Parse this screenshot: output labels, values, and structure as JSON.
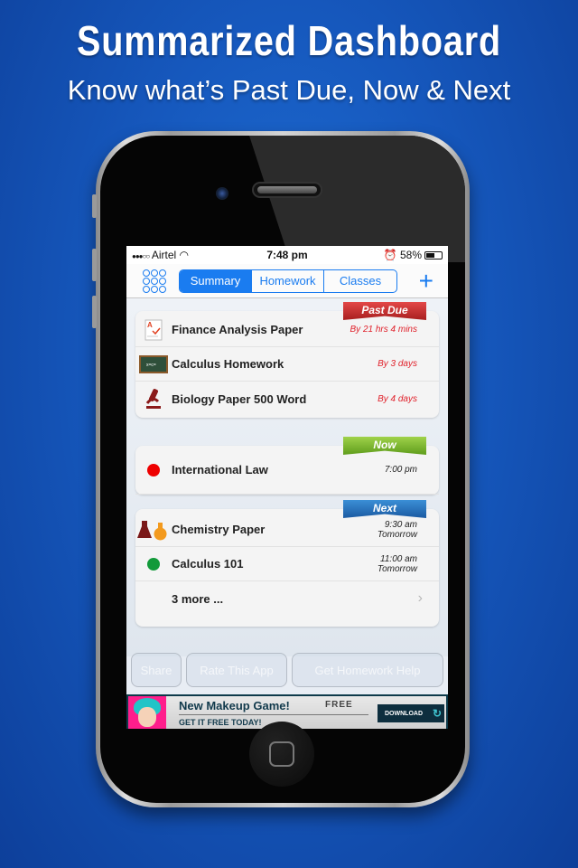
{
  "promo": {
    "headline": "Summarized Dashboard",
    "subheadline": "Know what’s Past Due, Now & Next"
  },
  "status_bar": {
    "signal": "●●●○○",
    "carrier": "Airtel",
    "wifi_icon": "wifi-icon",
    "time": "7:48 pm",
    "alarm_icon": "alarm-icon",
    "battery_text": "58%",
    "battery_level": 0.58
  },
  "nav": {
    "menu_icon": "grid-menu-icon",
    "tabs": [
      {
        "label": "Summary",
        "active": true
      },
      {
        "label": "Homework",
        "active": false
      },
      {
        "label": "Classes",
        "active": false
      }
    ],
    "add_icon": "+"
  },
  "sections": {
    "past_due": {
      "ribbon": "Past Due",
      "ribbon_color": "#c62a2a",
      "items": [
        {
          "icon": "paper-graded-icon",
          "title": "Finance Analysis Paper",
          "due": "By 21 hrs 4 mins"
        },
        {
          "icon": "chalkboard-icon",
          "title": "Calculus Homework",
          "due": "By 3 days"
        },
        {
          "icon": "microscope-icon",
          "title": "Biology Paper 500 Word",
          "due": "By 4 days"
        }
      ]
    },
    "now": {
      "ribbon": "Now",
      "ribbon_color": "#7ab532",
      "items": [
        {
          "icon": "red-dot-icon",
          "color": "#ee0000",
          "title": "International Law",
          "time": "7:00 pm"
        }
      ]
    },
    "next": {
      "ribbon": "Next",
      "ribbon_color": "#2a74c0",
      "items": [
        {
          "icon": "flasks-icon",
          "title": "Chemistry Paper",
          "time": "9:30 am",
          "day": "Tomorrow"
        },
        {
          "icon": "green-dot-icon",
          "color": "#129a3a",
          "title": "Calculus 101",
          "time": "11:00 am",
          "day": "Tomorrow"
        }
      ],
      "more": "3 more ..."
    }
  },
  "buttons": {
    "share": "Share",
    "rate": "Rate This App",
    "help": "Get Homework Help"
  },
  "ad": {
    "title": "New Makeup Game!",
    "badge": "FREE",
    "subtitle": "GET IT FREE TODAY!",
    "cta": "DOWNLOAD"
  }
}
